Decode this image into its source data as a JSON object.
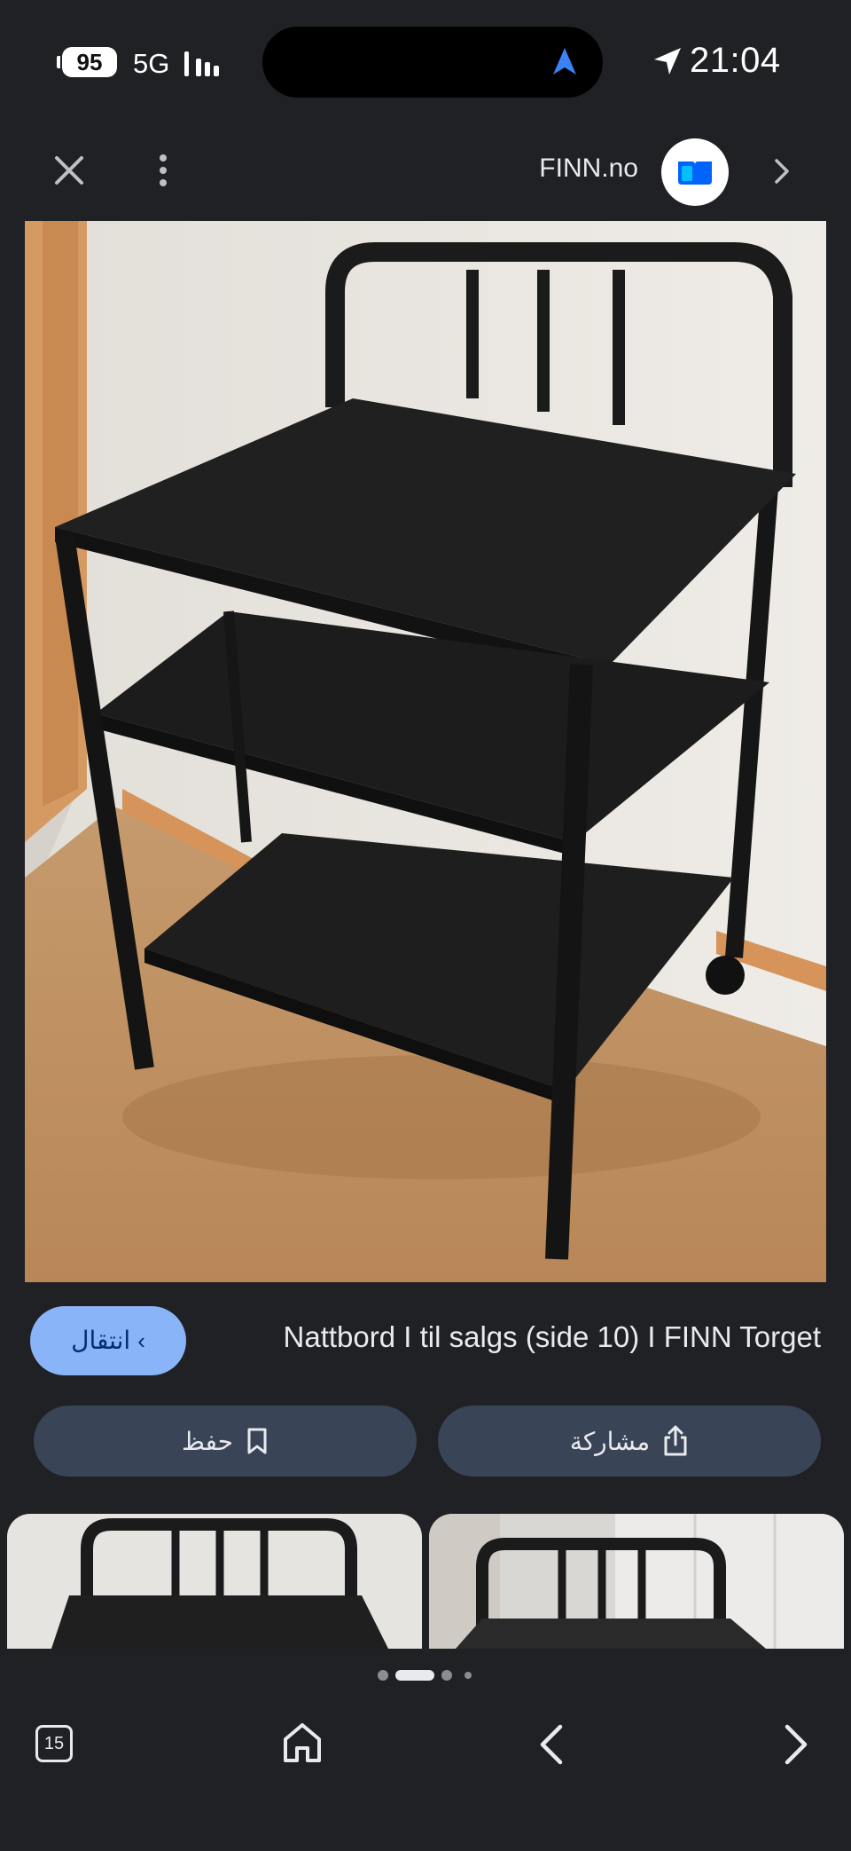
{
  "status_bar": {
    "battery": "95",
    "network": "5G",
    "time": "21:04"
  },
  "top_nav": {
    "site_name": "FINN.no",
    "icons": [
      "close-icon",
      "more-vert-icon",
      "finn-logo",
      "chevron-right-icon"
    ]
  },
  "result": {
    "open_label": "انتقال",
    "title": "Nattbord I til salgs (side 10) I FINN Torget"
  },
  "actions": {
    "save_label": "حفظ",
    "share_label": "مشاركة"
  },
  "pager": {
    "count": 4,
    "active_index": 1
  },
  "bottom_bar": {
    "tab_count": "15",
    "icons": [
      "tabs-icon",
      "home-icon",
      "back-icon",
      "forward-icon"
    ]
  },
  "colors": {
    "background": "#202124",
    "accent_button": "#8ab4f8",
    "action_button": "#394457",
    "finn_blue": "#0063fb"
  }
}
